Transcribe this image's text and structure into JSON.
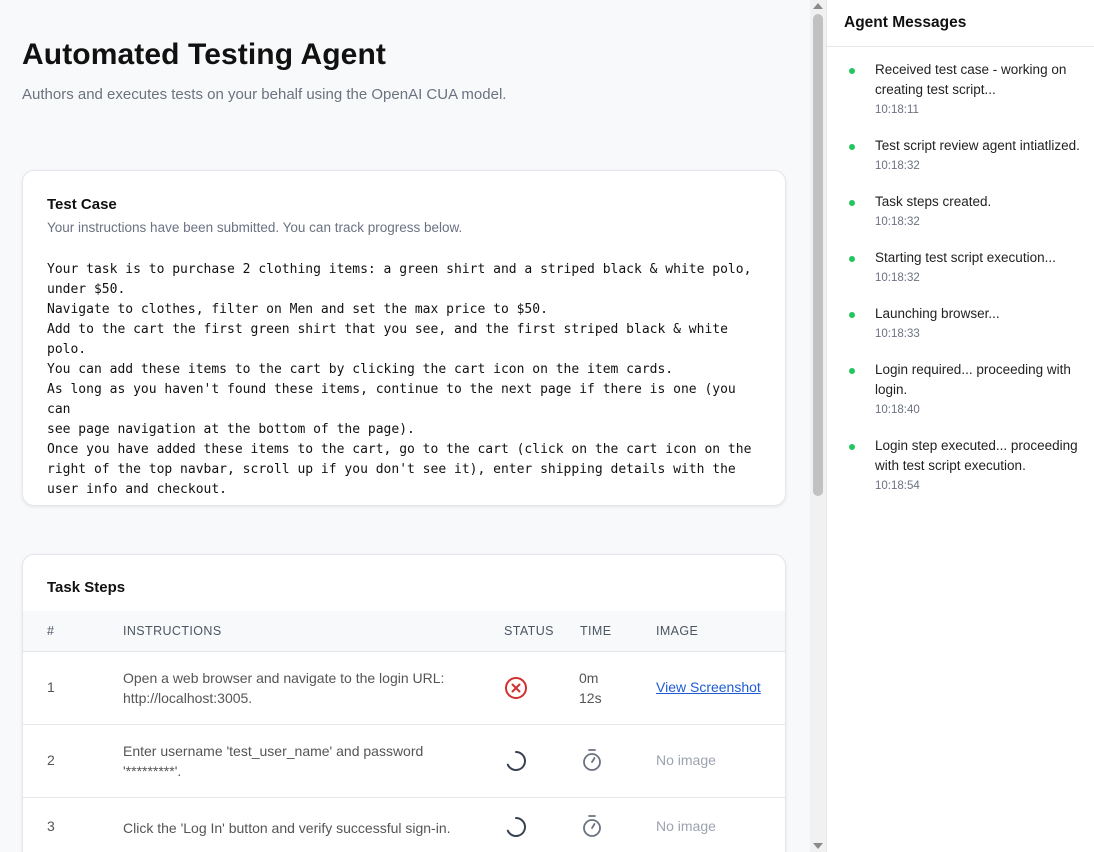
{
  "header": {
    "title": "Automated Testing Agent",
    "subtitle": "Authors and executes tests on your behalf using the OpenAI CUA model."
  },
  "test_case": {
    "title": "Test Case",
    "subtitle": "Your instructions have been submitted. You can track progress below.",
    "text": "Your task is to purchase 2 clothing items: a green shirt and a striped black & white polo,\nunder $50.\nNavigate to clothes, filter on Men and set the max price to $50.\nAdd to the cart the first green shirt that you see, and the first striped black & white\npolo.\nYou can add these items to the cart by clicking the cart icon on the item cards.\nAs long as you haven't found these items, continue to the next page if there is one (you can\nsee page navigation at the bottom of the page).\nOnce you have added these items to the cart, go to the cart (click on the cart icon on the\nright of the top navbar, scroll up if you don't see it), enter shipping details with the\nuser info and checkout."
  },
  "task_steps": {
    "title": "Task Steps",
    "columns": {
      "num": "#",
      "instructions": "INSTRUCTIONS",
      "status": "STATUS",
      "time": "TIME",
      "image": "IMAGE"
    },
    "rows": [
      {
        "num": "1",
        "instruction": "Open a web browser and navigate to the login URL: http://localhost:3005.",
        "status": "error",
        "status_icon": "error-x-circle-icon",
        "time_line1": "0m",
        "time_line2": "12s",
        "image": "View Screenshot"
      },
      {
        "num": "2",
        "instruction": "Enter username 'test_user_name' and password '*********'.",
        "status": "pending",
        "status_icon": "spinner-icon",
        "time_icon": "stopwatch-icon",
        "image": "No image"
      },
      {
        "num": "3",
        "instruction": "Click the 'Log In' button and verify successful sign-in.",
        "status": "pending",
        "status_icon": "spinner-icon",
        "time_icon": "stopwatch-icon",
        "image": "No image"
      }
    ]
  },
  "agent_messages": {
    "title": "Agent Messages",
    "dot_color": "#22c55e",
    "items": [
      {
        "text": "Received test case - working on creating test script...",
        "time": "10:18:11"
      },
      {
        "text": "Test script review agent intiatlized.",
        "time": "10:18:32"
      },
      {
        "text": "Task steps created.",
        "time": "10:18:32"
      },
      {
        "text": "Starting test script execution...",
        "time": "10:18:32"
      },
      {
        "text": "Launching browser...",
        "time": "10:18:33"
      },
      {
        "text": "Login required... proceeding with login.",
        "time": "10:18:40"
      },
      {
        "text": "Login step executed... proceeding with test script execution.",
        "time": "10:18:54"
      }
    ]
  },
  "colors": {
    "error": "#d32f2f",
    "spinner": "#374151",
    "link": "#1d5bd6"
  }
}
